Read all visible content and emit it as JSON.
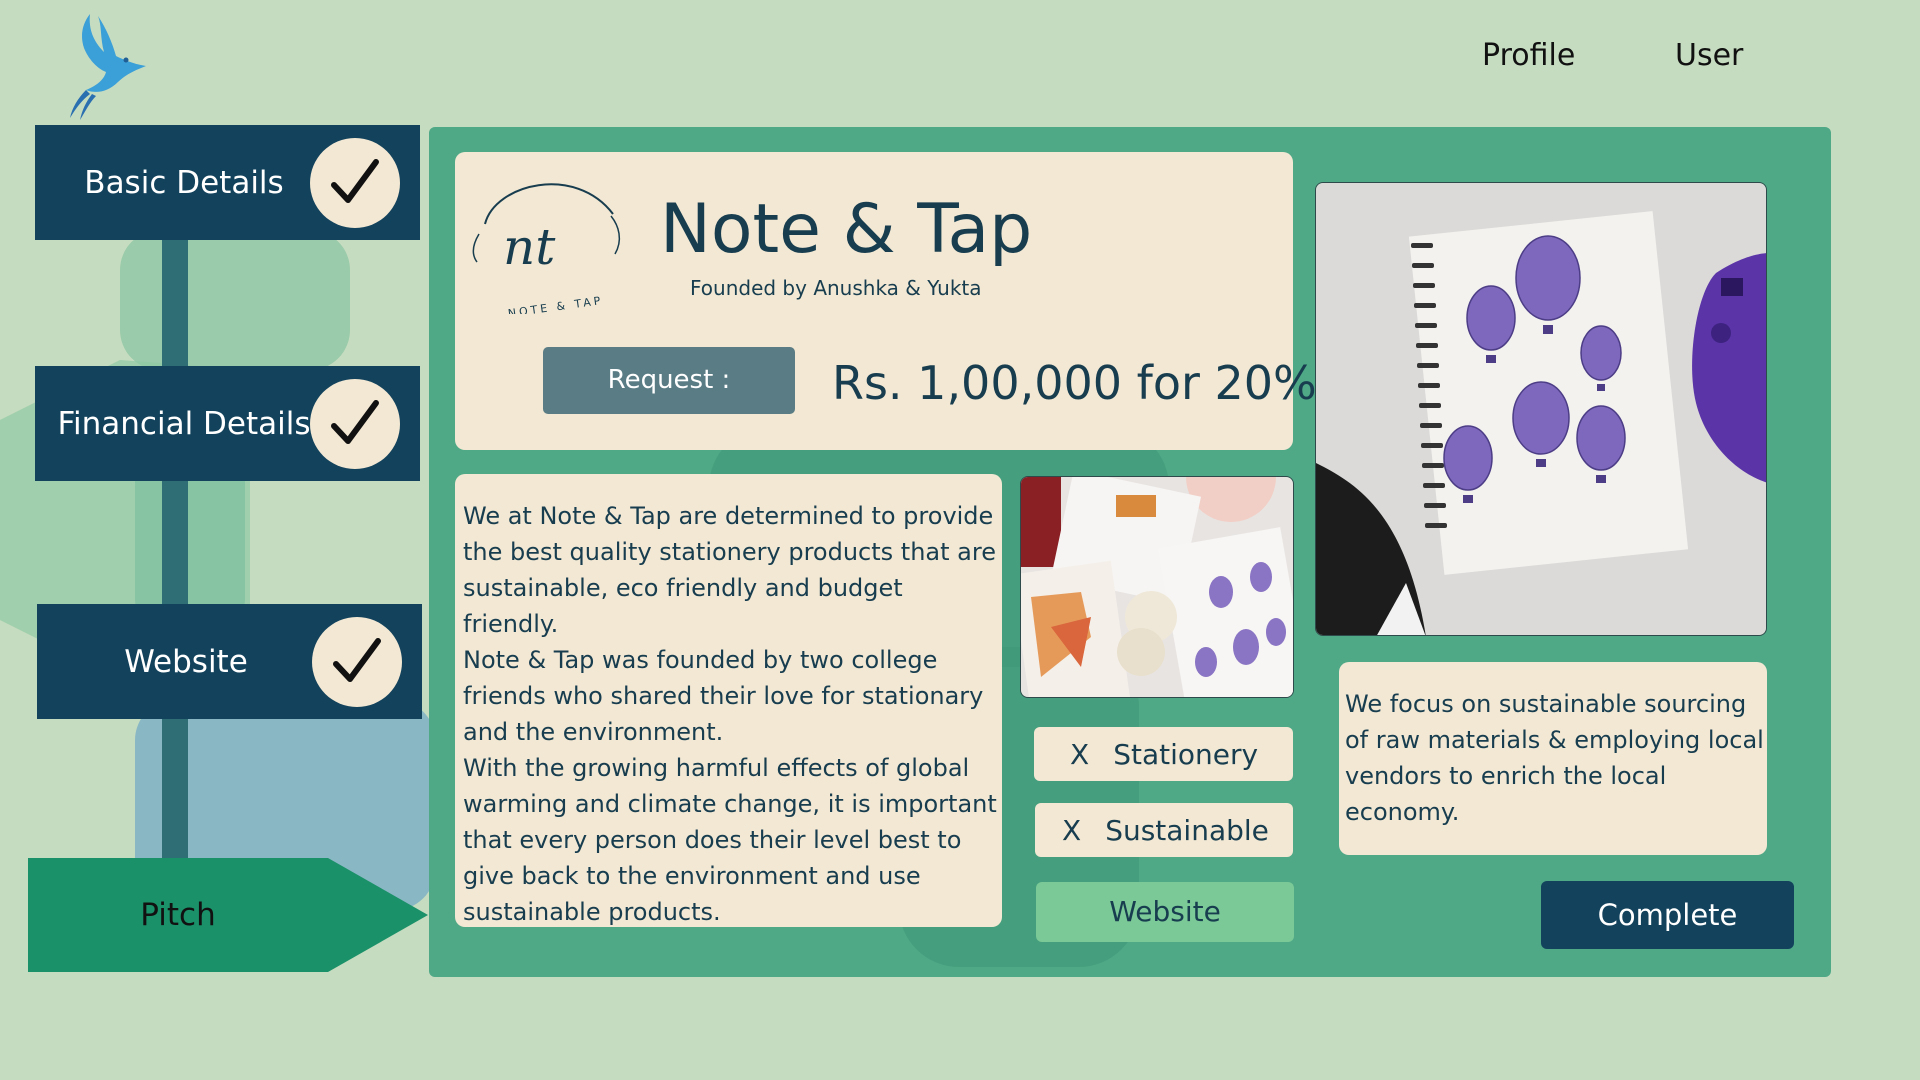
{
  "nav": {
    "profile": "Profile",
    "user": "User"
  },
  "steps": [
    {
      "label": "Basic Details",
      "done": true
    },
    {
      "label": "Financial Details",
      "done": true
    },
    {
      "label": "Website",
      "done": true
    },
    {
      "label": "Pitch",
      "active": true
    }
  ],
  "startup": {
    "name": "Note & Tap",
    "founders": "Founded by Anushka & Yukta",
    "logo_text": {
      "mono": "nt",
      "wordmark": "NOTE & TAP"
    },
    "request_label": "Request :",
    "offer": "Rs. 1,00,000 for 20%",
    "description": [
      "We at Note & Tap are determined to provide the best quality stationery products that are sustainable, eco friendly and budget friendly.",
      "Note & Tap was founded by two college friends who shared their love for stationary and the environment.",
      "With the growing harmful effects of global warming and climate change, it is important that every person does their level best to give back to the environment and use sustainable products."
    ],
    "tags": [
      {
        "remove": "X",
        "label": "Stationery"
      },
      {
        "remove": "X",
        "label": "Sustainable"
      }
    ],
    "website_button": "Website",
    "focus": "We focus on sustainable sourcing of raw materials & employing local vendors to enrich the local economy.",
    "complete_button": "Complete"
  },
  "colors": {
    "background": "#c6dcc0",
    "panel": "#4fa886",
    "card": "#f3e8d3",
    "navy": "#12425c",
    "pitch": "#1a9168",
    "website_button": "#7bc997"
  }
}
